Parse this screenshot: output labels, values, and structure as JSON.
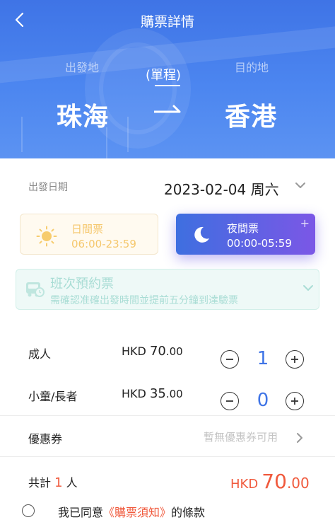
{
  "header": {
    "title": "購票詳情",
    "from_label": "出發地",
    "to_label": "目的地",
    "trip_type": "(單程)",
    "from_city": "珠海",
    "to_city": "香港"
  },
  "date": {
    "label": "出發日期",
    "value": "2023-02-04 周六"
  },
  "periods": {
    "day": {
      "title": "日間票",
      "time": "06:00-23:59",
      "selected": false
    },
    "night": {
      "title": "夜間票",
      "time": "00:00-05:59",
      "selected": true,
      "mark": "+"
    }
  },
  "reservation": {
    "title": "班次預約票",
    "subtitle": "需確認准確出發時間並提前五分鐘到達驗票"
  },
  "passengers": [
    {
      "label": "成人",
      "currency": "HKD",
      "price_int": "70",
      "price_dec": ".00",
      "count": "1"
    },
    {
      "label": "小童/長者",
      "currency": "HKD",
      "price_int": "35",
      "price_dec": ".00",
      "count": "0"
    }
  ],
  "coupon": {
    "label": "優惠券",
    "value": "暫無優惠券可用"
  },
  "total": {
    "prefix": "共計",
    "count": "1",
    "suffix": "人",
    "currency": "HKD",
    "amount_int": "70",
    "amount_dec": ".00"
  },
  "agreement": {
    "prefix": "我已同意",
    "link": "《購票須知》",
    "suffix": "的條款"
  },
  "colors": {
    "primary": "#3f74e6",
    "accent": "#f05a3d",
    "night_gradient_end": "#7b57e6"
  }
}
